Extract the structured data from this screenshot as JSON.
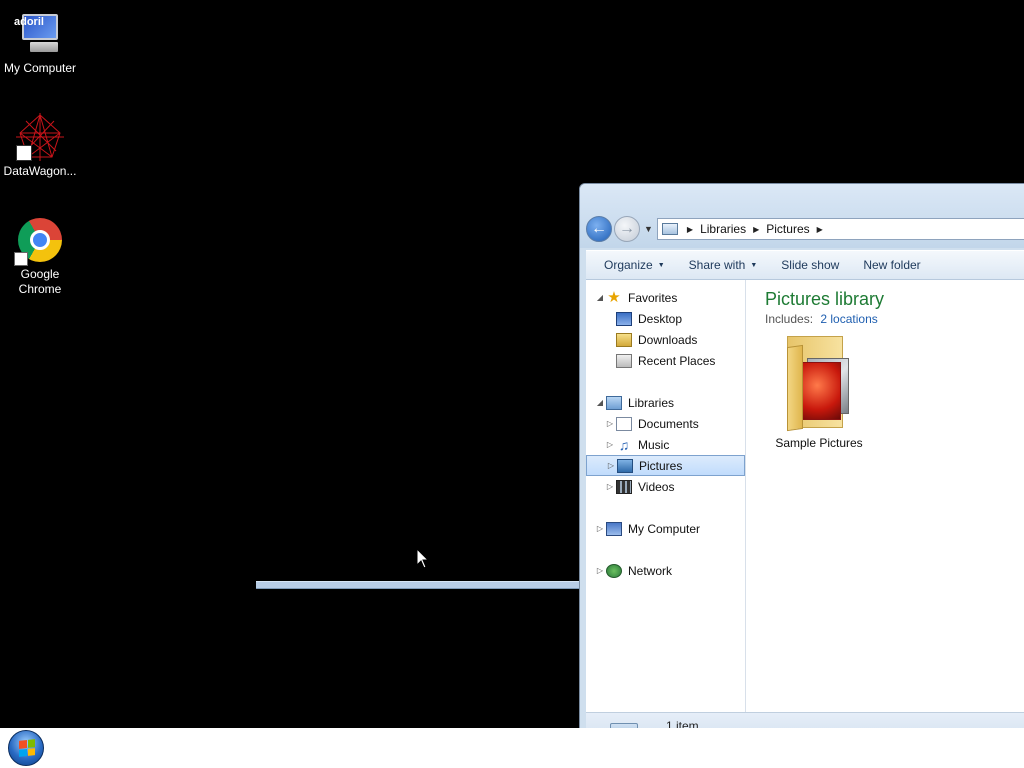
{
  "desktop": {
    "icons": [
      {
        "label": "My Computer",
        "overlay_text": "adoril",
        "icon": "my-computer-icon"
      },
      {
        "label": "DataWagon...",
        "icon": "datawagon-icon"
      },
      {
        "label": "Google Chrome",
        "icon": "chrome-icon"
      }
    ]
  },
  "explorer": {
    "address": {
      "segments": [
        "Libraries",
        "Pictures"
      ]
    },
    "toolbar": {
      "organize": "Organize",
      "share_with": "Share with",
      "slide_show": "Slide show",
      "new_folder": "New folder"
    },
    "nav_pane": {
      "favorites": "Favorites",
      "desktop": "Desktop",
      "downloads": "Downloads",
      "recent_places": "Recent Places",
      "libraries": "Libraries",
      "documents": "Documents",
      "music": "Music",
      "pictures": "Pictures",
      "videos": "Videos",
      "my_computer": "My Computer",
      "network": "Network"
    },
    "content": {
      "title": "Pictures library",
      "includes_label": "Includes:",
      "includes_link": "2 locations",
      "items": [
        {
          "label": "Sample Pictures"
        }
      ]
    },
    "details": {
      "count": "1 item"
    }
  },
  "colors": {
    "library_title": "#1e7b34",
    "link": "#1f5fb0",
    "selection": "#c1dcfc"
  }
}
